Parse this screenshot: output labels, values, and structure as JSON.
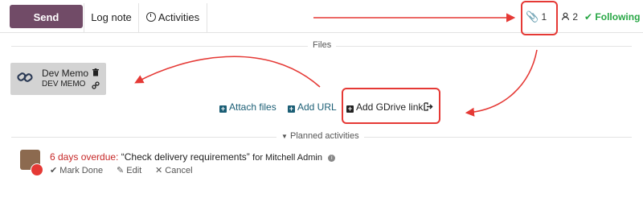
{
  "composer": {
    "send_message_label": "Send message",
    "log_note_label": "Log note",
    "activities_label": "Activities",
    "attachments_count": "1",
    "followers_count": "2",
    "following_label": "Following"
  },
  "files_section": {
    "title": "Files",
    "files": [
      {
        "name": "Dev Memo",
        "type": "DEV MEMO"
      }
    ],
    "actions": {
      "attach_files": "Attach files",
      "add_url": "Add URL",
      "add_gdrive_link": "Add GDrive link"
    }
  },
  "planned_activities": {
    "title": "Planned activities",
    "items": [
      {
        "overdue_text": "6 days overdue:",
        "summary": "“Check delivery requirements”",
        "assignee_prefix": "for Mitchell Admin",
        "actions": {
          "mark_done": "Mark Done",
          "edit": "Edit",
          "cancel": "Cancel"
        }
      }
    ]
  },
  "colors": {
    "primary": "#714b67",
    "following": "#28a745",
    "link": "#1b5e75",
    "annotation": "#e53935",
    "overdue": "#c62828"
  }
}
